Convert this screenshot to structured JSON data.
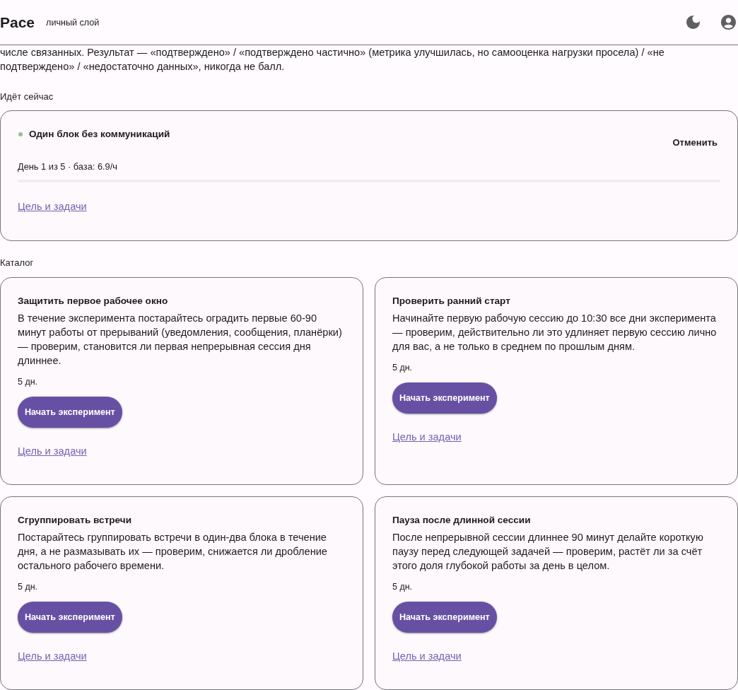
{
  "header": {
    "title": "Pace",
    "subtitle": "личный слой"
  },
  "intro": "числе связанных. Результат — «подтверждено» / «подтверждено частично» (метрика улучшилась, но самооценка нагрузки просела) / «не подтверждено» / «недостаточно данных», никогда не балл.",
  "running": {
    "heading": "Идёт сейчас",
    "experiments": [
      {
        "title": "Один блок без коммуникаций",
        "cancel_button": "Отменить",
        "meta": "День 1 из 5 · база: 6.9/ч",
        "link": "Цель и задачи"
      }
    ]
  },
  "catalog": {
    "heading": "Каталог",
    "items": [
      {
        "title": "Защитить первое рабочее окно",
        "description": "В течение эксперимента постарайтесь оградить первые 60-90 минут работы от прерываний (уведомления, сообщения, планёрки) — проверим, становится ли первая непрерывная сессия дня длиннее.",
        "duration": "5 дн.",
        "button": "Начать эксперимент",
        "link": "Цель и задачи"
      },
      {
        "title": "Проверить ранний старт",
        "description": "Начинайте первую рабочую сессию до 10:30 все дни эксперимента — проверим, действительно ли это удлиняет первую сессию лично для вас, а не только в среднем по прошлым дням.",
        "duration": "5 дн.",
        "button": "Начать эксперимент",
        "link": "Цель и задачи"
      },
      {
        "title": "Сгруппировать встречи",
        "description": "Постарайтесь группировать встречи в один-два блока в течение дня, а не размазывать их — проверим, снижается ли дробление остального рабочего времени.",
        "duration": "5 дн.",
        "button": "Начать эксперимент",
        "link": "Цель и задачи"
      },
      {
        "title": "Пауза после длинной сессии",
        "description": "После непрерывной сессии длиннее 90 минут делайте короткую паузу перед следующей задачей — проверим, растёт ли за счёт этого доля глубокой работы за день в целом.",
        "duration": "5 дн.",
        "button": "Начать эксперимент",
        "link": "Цель и задачи"
      }
    ]
  }
}
